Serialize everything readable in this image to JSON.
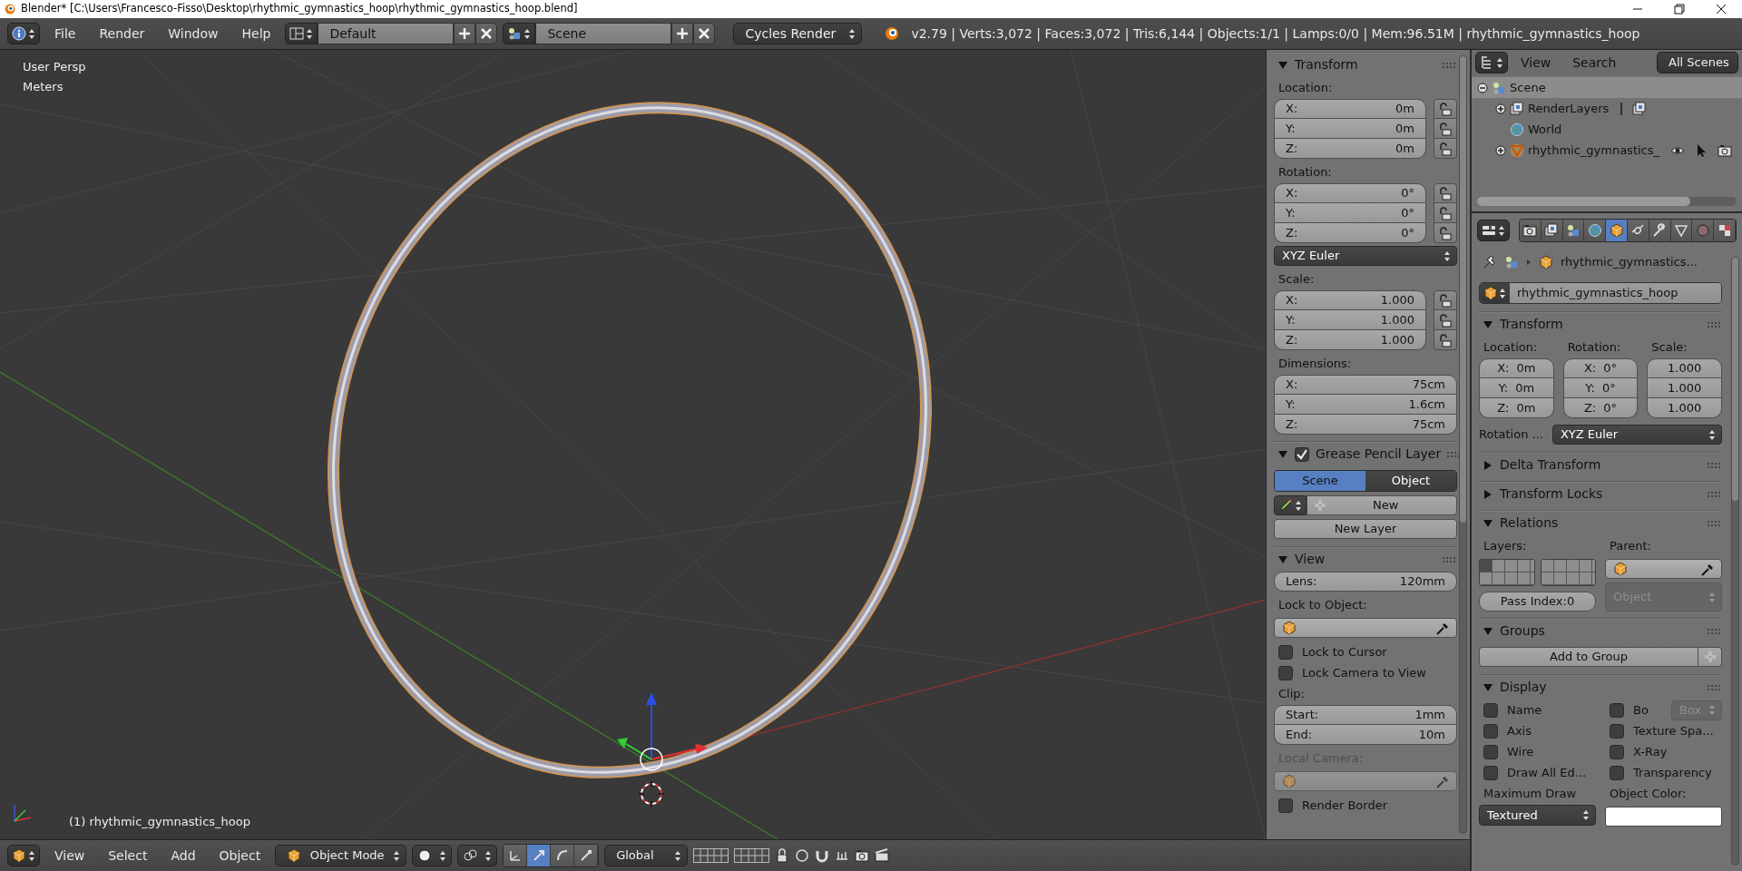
{
  "title_bar": {
    "title": "Blender* [C:\\Users\\Francesco-Fisso\\Desktop\\rhythmic_gymnastics_hoop\\rhythmic_gymnastics_hoop.blend]"
  },
  "header": {
    "menus": [
      {
        "label": "File"
      },
      {
        "label": "Render"
      },
      {
        "label": "Window"
      },
      {
        "label": "Help"
      }
    ],
    "layout": "Default",
    "scene": "Scene",
    "engine": "Cycles Render",
    "stats": "v2.79 | Verts:3,072 | Faces:3,072 | Tris:6,144 | Objects:1/1 | Lamps:0/0 | Mem:96.51M | rhythmic_gymnastics_hoop"
  },
  "viewport": {
    "view_name": "User Persp",
    "units": "Meters",
    "object_label": "(1) rhythmic_gymnastics_hoop"
  },
  "viewport_header": {
    "menus": [
      {
        "label": "View"
      },
      {
        "label": "Select"
      },
      {
        "label": "Add"
      },
      {
        "label": "Object"
      }
    ],
    "mode": "Object Mode",
    "orientation": "Global",
    "manipulators": [
      {
        "kind": "axes",
        "selected": false
      },
      {
        "kind": "translate",
        "selected": true
      },
      {
        "kind": "rotate",
        "selected": false
      },
      {
        "kind": "scale",
        "selected": false
      }
    ]
  },
  "n_panel": {
    "panels": [
      {
        "title": "Transform",
        "expanded": true,
        "rows": [
          {
            "kind": "label",
            "text": "Location:"
          },
          {
            "kind": "fields",
            "items": [
              {
                "label": "X:",
                "value": "0m",
                "locked": false
              },
              {
                "label": "Y:",
                "value": "0m",
                "locked": false
              },
              {
                "label": "Z:",
                "value": "0m",
                "locked": false
              }
            ]
          },
          {
            "kind": "label",
            "text": "Rotation:"
          },
          {
            "kind": "fields",
            "items": [
              {
                "label": "X:",
                "value": "0°",
                "locked": false
              },
              {
                "label": "Y:",
                "value": "0°",
                "locked": false
              },
              {
                "label": "Z:",
                "value": "0°",
                "locked": false
              }
            ]
          },
          {
            "kind": "dropdown",
            "value": "XYZ Euler"
          },
          {
            "kind": "label",
            "text": "Scale:"
          },
          {
            "kind": "fields",
            "items": [
              {
                "label": "X:",
                "value": "1.000",
                "locked": false
              },
              {
                "label": "Y:",
                "value": "1.000",
                "locked": false
              },
              {
                "label": "Z:",
                "value": "1.000",
                "locked": false
              }
            ]
          },
          {
            "kind": "label",
            "text": "Dimensions:"
          },
          {
            "kind": "fields",
            "items": [
              {
                "label": "X:",
                "value": "75cm"
              },
              {
                "label": "Y:",
                "value": "1.6cm"
              },
              {
                "label": "Z:",
                "value": "75cm"
              }
            ]
          }
        ]
      },
      {
        "title": "Grease Pencil Layer",
        "expanded": true,
        "checked": true,
        "rows": [
          {
            "kind": "toggle",
            "options": [
              {
                "label": "Scene",
                "selected": true
              },
              {
                "label": "Object",
                "selected": false
              }
            ]
          },
          {
            "kind": "new",
            "label": "New"
          },
          {
            "kind": "button",
            "label": "New Layer"
          }
        ]
      },
      {
        "title": "View",
        "expanded": true,
        "rows": [
          {
            "kind": "fields",
            "items": [
              {
                "label": "Lens:",
                "value": "120mm"
              }
            ]
          },
          {
            "kind": "label",
            "text": "Lock to Object:"
          },
          {
            "kind": "picker",
            "disabled": false
          },
          {
            "kind": "checkbox",
            "label": "Lock to Cursor",
            "checked": false
          },
          {
            "kind": "checkbox",
            "label": "Lock Camera to View",
            "checked": false
          },
          {
            "kind": "label",
            "text": "Clip:"
          },
          {
            "kind": "fields",
            "items": [
              {
                "label": "Start:",
                "value": "1mm"
              },
              {
                "label": "End:",
                "value": "10m"
              }
            ]
          },
          {
            "kind": "label",
            "text": "Local Camera:",
            "disabled": true
          },
          {
            "kind": "picker",
            "disabled": true
          },
          {
            "kind": "checkbox",
            "label": "Render Border",
            "checked": false
          }
        ]
      }
    ]
  },
  "outliner": {
    "menus": [
      {
        "label": "View"
      },
      {
        "label": "Search"
      }
    ],
    "filter": "All Scenes",
    "tree": [
      {
        "kind": "scene",
        "label": "Scene",
        "expanded": true,
        "selected": true,
        "children": [
          {
            "kind": "render_layers",
            "label": "RenderLayers",
            "expanded": false,
            "selected": false
          },
          {
            "kind": "world",
            "label": "World",
            "selected": false
          },
          {
            "kind": "object",
            "label": "rhythmic_gymnastics_",
            "expanded": false,
            "selected": false
          }
        ]
      }
    ]
  },
  "properties": {
    "tabs": [
      {
        "kind": "render",
        "selected": false
      },
      {
        "kind": "render_layers",
        "selected": false
      },
      {
        "kind": "scene",
        "selected": false
      },
      {
        "kind": "world",
        "selected": false
      },
      {
        "kind": "object",
        "selected": true
      },
      {
        "kind": "constraints",
        "selected": false
      },
      {
        "kind": "modifiers",
        "selected": false
      },
      {
        "kind": "data",
        "selected": false
      },
      {
        "kind": "material",
        "selected": false
      },
      {
        "kind": "texture",
        "selected": false
      }
    ],
    "breadcrumb": "rhythmic_gymnastics...",
    "object_name": "rhythmic_gymnastics_hoop",
    "panels": [
      {
        "title": "Transform",
        "expanded": true,
        "rows": [
          {
            "kind": "columns",
            "columns": [
              [
                {
                  "kind": "label",
                  "text": "Location:"
                },
                {
                  "kind": "fields",
                  "items": [
                    {
                      "label": "X:",
                      "value": "0m"
                    },
                    {
                      "label": "Y:",
                      "value": "0m"
                    },
                    {
                      "label": "Z:",
                      "value": "0m"
                    }
                  ]
                }
              ],
              [
                {
                  "kind": "label",
                  "text": "Rotation:"
                },
                {
                  "kind": "fields",
                  "items": [
                    {
                      "label": "X:",
                      "value": "0°"
                    },
                    {
                      "label": "Y:",
                      "value": "0°"
                    },
                    {
                      "label": "Z:",
                      "value": "0°"
                    }
                  ]
                }
              ],
              [
                {
                  "kind": "label",
                  "text": "Scale:"
                },
                {
                  "kind": "fields",
                  "items": [
                    {
                      "value": "1.000"
                    },
                    {
                      "value": "1.000"
                    },
                    {
                      "value": "1.000"
                    }
                  ]
                }
              ]
            ]
          },
          {
            "kind": "labeled_dropdown",
            "label": "Rotation ...",
            "value": "XYZ Euler"
          }
        ]
      },
      {
        "title": "Delta Transform",
        "expanded": false
      },
      {
        "title": "Transform Locks",
        "expanded": false
      },
      {
        "title": "Relations",
        "expanded": true,
        "rows": [
          {
            "kind": "columns",
            "columns": [
              [
                {
                  "kind": "label",
                  "text": "Layers:"
                },
                {
                  "kind": "layers",
                  "cells": [
                    {
                      "selected": true
                    },
                    {
                      "selected": false
                    },
                    {
                      "selected": false
                    },
                    {
                      "selected": false
                    },
                    {
                      "selected": false
                    },
                    {
                      "selected": false
                    },
                    {
                      "selected": false
                    },
                    {
                      "selected": false
                    },
                    {
                      "selected": false
                    },
                    {
                      "selected": false
                    },
                    {
                      "selected": false
                    },
                    {
                      "selected": false
                    },
                    {
                      "selected": false
                    },
                    {
                      "selected": false
                    },
                    {
                      "selected": false
                    },
                    {
                      "selected": false
                    },
                    {
                      "selected": false
                    },
                    {
                      "selected": false
                    },
                    {
                      "selected": false
                    },
                    {
                      "selected": false
                    }
                  ]
                },
                {
                  "kind": "fields",
                  "items": [
                    {
                      "value": "Pass Index:0"
                    }
                  ]
                }
              ],
              [
                {
                  "kind": "label",
                  "text": "Parent:"
                },
                {
                  "kind": "picker",
                  "disabled": false
                },
                {
                  "kind": "dropdown",
                  "value": "Object",
                  "disabled": true
                }
              ]
            ]
          }
        ]
      },
      {
        "title": "Groups",
        "expanded": true,
        "rows": [
          {
            "kind": "button",
            "label": "Add to Group",
            "plus": true
          }
        ]
      },
      {
        "title": "Display",
        "expanded": true,
        "rows": [
          {
            "kind": "columns",
            "columns": [
              [
                {
                  "kind": "checkbox",
                  "label": "Name",
                  "checked": false
                },
                {
                  "kind": "checkbox",
                  "label": "Axis",
                  "checked": false
                },
                {
                  "kind": "checkbox",
                  "label": "Wire",
                  "checked": false
                },
                {
                  "kind": "checkbox",
                  "label": "Draw All Ed...",
                  "checked": false
                }
              ],
              [
                {
                  "kind": "checkbox",
                  "label": "Bo",
                  "checked": false,
                  "option": "Box"
                },
                {
                  "kind": "checkbox",
                  "label": "Texture Spa...",
                  "checked": false
                },
                {
                  "kind": "checkbox",
                  "label": "X-Ray",
                  "checked": false
                },
                {
                  "kind": "checkbox",
                  "label": "Transparency",
                  "checked": false
                }
              ]
            ]
          },
          {
            "kind": "columns",
            "columns": [
              [
                {
                  "kind": "label",
                  "text": "Maximum Draw"
                },
                {
                  "kind": "dropdown",
                  "value": "Textured"
                }
              ],
              [
                {
                  "kind": "label",
                  "text": "Object Color:"
                },
                {
                  "kind": "swatch",
                  "color": "#ffffff"
                }
              ]
            ]
          }
        ]
      }
    ]
  }
}
